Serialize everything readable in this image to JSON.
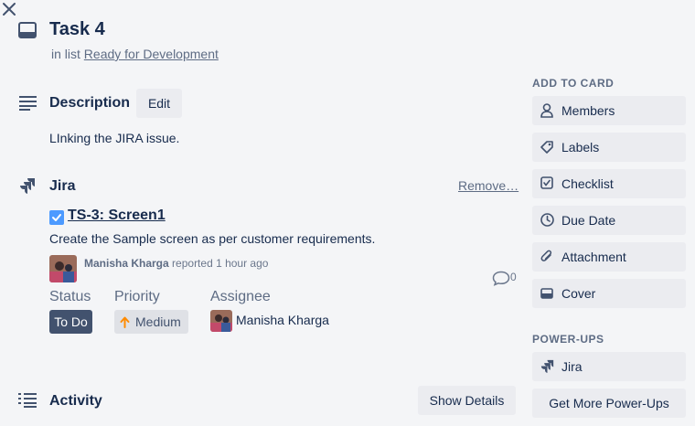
{
  "card": {
    "title": "Task 4",
    "list_prefix": "in list",
    "list_name": "Ready for Development"
  },
  "description": {
    "heading": "Description",
    "edit_label": "Edit",
    "text": "LInking the JIRA issue."
  },
  "jira": {
    "heading": "Jira",
    "remove_label": "Remove…",
    "issue_key_title": "TS-3: Screen1",
    "issue_summary": "Create the Sample screen as per customer requirements.",
    "reporter_name": "Manisha Kharga",
    "reported_text": "reported 1 hour ago",
    "comment_count": "0",
    "status_label": "Status",
    "status_value": "To Do",
    "priority_label": "Priority",
    "priority_value": "Medium",
    "assignee_label": "Assignee",
    "assignee_name": "Manisha Kharga"
  },
  "activity": {
    "heading": "Activity",
    "show_details_label": "Show Details"
  },
  "sidebar": {
    "add_to_card_label": "ADD TO CARD",
    "buttons": [
      {
        "label": "Members",
        "icon": "person-icon"
      },
      {
        "label": "Labels",
        "icon": "tag-icon"
      },
      {
        "label": "Checklist",
        "icon": "checkbox-icon"
      },
      {
        "label": "Due Date",
        "icon": "clock-icon"
      },
      {
        "label": "Attachment",
        "icon": "paperclip-icon"
      },
      {
        "label": "Cover",
        "icon": "cover-icon"
      }
    ],
    "power_ups_label": "POWER-UPS",
    "power_up_jira": "Jira",
    "get_more_label": "Get More Power-Ups"
  },
  "colors": {
    "status_badge_bg": "#42526e",
    "priority_badge_bg": "#dfe1e6",
    "priority_arrow": "#ff8b00",
    "checkbox_blue": "#4c9aff"
  }
}
